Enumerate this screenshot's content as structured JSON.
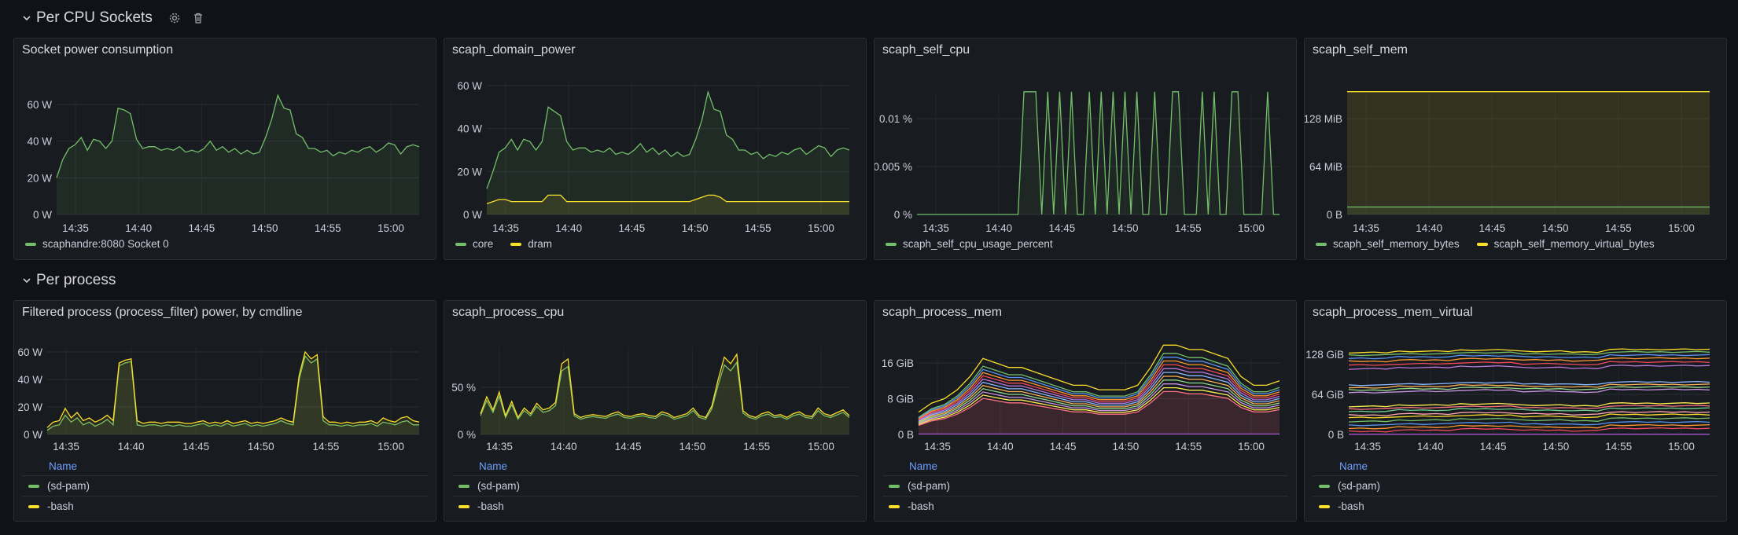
{
  "rows": [
    {
      "title": "Per CPU Sockets"
    },
    {
      "title": "Per process"
    }
  ],
  "colors": {
    "green": "#73bf69",
    "yellow": "#fade2a",
    "purple": "#a352cc",
    "blue_link": "#6e9fff"
  },
  "x_ticks": [
    "14:35",
    "14:40",
    "14:45",
    "14:50",
    "14:55",
    "15:00"
  ],
  "panels": [
    {
      "title": "Socket power consumption",
      "y_ticks": [
        "0 W",
        "20 W",
        "40 W",
        "60 W"
      ],
      "legend": [
        {
          "name": "scaphandre:8080 Socket 0",
          "color": "#73bf69"
        }
      ]
    },
    {
      "title": "scaph_domain_power",
      "y_ticks": [
        "0 W",
        "20 W",
        "40 W",
        "60 W"
      ],
      "legend": [
        {
          "name": "core",
          "color": "#73bf69"
        },
        {
          "name": "dram",
          "color": "#fade2a"
        }
      ]
    },
    {
      "title": "scaph_self_cpu",
      "y_ticks": [
        "0 %",
        "0.005 %",
        "0.01 %"
      ],
      "legend": [
        {
          "name": "scaph_self_cpu_usage_percent",
          "color": "#73bf69"
        }
      ]
    },
    {
      "title": "scaph_self_mem",
      "y_ticks": [
        "0 B",
        "64 MiB",
        "128 MiB"
      ],
      "legend": [
        {
          "name": "scaph_self_memory_bytes",
          "color": "#73bf69"
        },
        {
          "name": "scaph_self_memory_virtual_bytes",
          "color": "#fade2a"
        }
      ]
    },
    {
      "title": "Filtered process (process_filter) power, by cmdline",
      "y_ticks": [
        "0 W",
        "20 W",
        "40 W",
        "60 W"
      ],
      "table_header": "Name",
      "legend": [
        {
          "name": "(sd-pam)",
          "color": "#73bf69"
        },
        {
          "name": "-bash",
          "color": "#fade2a"
        }
      ]
    },
    {
      "title": "scaph_process_cpu",
      "y_ticks": [
        "0 %",
        "50 %"
      ],
      "table_header": "Name",
      "legend": [
        {
          "name": "(sd-pam)",
          "color": "#73bf69"
        },
        {
          "name": "-bash",
          "color": "#fade2a"
        }
      ]
    },
    {
      "title": "scaph_process_mem",
      "y_ticks": [
        "0 B",
        "8 GiB",
        "16 GiB"
      ],
      "table_header": "Name",
      "legend": [
        {
          "name": "(sd-pam)",
          "color": "#73bf69"
        },
        {
          "name": "-bash",
          "color": "#fade2a"
        }
      ]
    },
    {
      "title": "scaph_process_mem_virtual",
      "y_ticks": [
        "0 B",
        "64 GiB",
        "128 GiB"
      ],
      "table_header": "Name",
      "legend": [
        {
          "name": "(sd-pam)",
          "color": "#73bf69"
        },
        {
          "name": "-bash",
          "color": "#fade2a"
        }
      ]
    }
  ],
  "series": {
    "socket_power": [
      20,
      30,
      36,
      38,
      42,
      35,
      41,
      40,
      36,
      40,
      58,
      57,
      55,
      41,
      36,
      37,
      37,
      35,
      36,
      35,
      37,
      34,
      35,
      34,
      36,
      40,
      35,
      37,
      34,
      36,
      33,
      35,
      33,
      34,
      42,
      52,
      65,
      58,
      57,
      44,
      42,
      36,
      36,
      34,
      35,
      32,
      34,
      33,
      35,
      34,
      36,
      37,
      34,
      36,
      39,
      38,
      33,
      37,
      38,
      37
    ],
    "core_power": [
      12,
      20,
      29,
      31,
      35,
      30,
      35,
      34,
      30,
      34,
      50,
      48,
      46,
      34,
      30,
      31,
      31,
      29,
      30,
      29,
      31,
      28,
      29,
      28,
      30,
      33,
      29,
      31,
      28,
      30,
      27,
      29,
      27,
      28,
      35,
      44,
      57,
      49,
      48,
      37,
      35,
      30,
      30,
      28,
      29,
      26,
      28,
      27,
      29,
      28,
      30,
      31,
      28,
      30,
      32,
      31,
      27,
      30,
      31,
      30
    ],
    "dram_power": [
      5,
      6,
      7,
      7,
      6,
      6,
      6,
      6,
      6,
      6,
      9,
      9,
      9,
      6,
      6,
      6,
      6,
      6,
      6,
      6,
      6,
      6,
      6,
      6,
      6,
      6,
      6,
      6,
      6,
      6,
      6,
      6,
      6,
      6,
      7,
      8,
      9,
      9,
      8,
      6,
      6,
      6,
      6,
      6,
      6,
      6,
      6,
      6,
      6,
      6,
      6,
      6,
      6,
      6,
      6,
      6,
      6,
      6,
      6,
      6
    ],
    "self_cpu_pattern": [
      0,
      0,
      0,
      0,
      0,
      0,
      0,
      0,
      0,
      1,
      1,
      1,
      0,
      1,
      0,
      1,
      0,
      1,
      0,
      0,
      1,
      0,
      1,
      0,
      1,
      0,
      1,
      0,
      1,
      0,
      0,
      1,
      0,
      0,
      1,
      1,
      0,
      0,
      0,
      1,
      0,
      1,
      0,
      0,
      1,
      1,
      0,
      0,
      0,
      0,
      1,
      0,
      0,
      0,
      0,
      1
    ],
    "proc_power_bash": [
      5,
      9,
      10,
      19,
      12,
      16,
      10,
      12,
      9,
      11,
      14,
      10,
      52,
      54,
      55,
      10,
      8,
      9,
      9,
      8,
      9,
      9,
      9,
      8,
      8,
      9,
      10,
      8,
      9,
      8,
      10,
      8,
      9,
      10,
      8,
      9,
      8,
      9,
      10,
      12,
      10,
      9,
      43,
      60,
      55,
      58,
      13,
      9,
      9,
      8,
      9,
      8,
      9,
      9,
      10,
      8,
      12,
      10,
      9,
      12,
      13,
      10,
      9
    ],
    "proc_power_sdpam": [
      3,
      6,
      7,
      14,
      9,
      12,
      7,
      9,
      6,
      8,
      11,
      7,
      50,
      52,
      53,
      7,
      6,
      7,
      7,
      6,
      7,
      6,
      7,
      6,
      6,
      7,
      8,
      6,
      7,
      6,
      8,
      6,
      7,
      8,
      6,
      7,
      6,
      7,
      8,
      10,
      8,
      7,
      40,
      57,
      52,
      55,
      10,
      7,
      7,
      6,
      7,
      6,
      7,
      7,
      8,
      6,
      9,
      8,
      7,
      9,
      10,
      7,
      7
    ],
    "proc_cpu": [
      22,
      40,
      26,
      45,
      20,
      35,
      18,
      28,
      22,
      33,
      26,
      28,
      34,
      75,
      80,
      22,
      18,
      20,
      21,
      20,
      19,
      22,
      24,
      20,
      19,
      21,
      22,
      20,
      19,
      24,
      22,
      18,
      20,
      22,
      28,
      20,
      18,
      30,
      58,
      82,
      75,
      85,
      25,
      20,
      18,
      22,
      24,
      20,
      21,
      18,
      22,
      24,
      20,
      19,
      28,
      22,
      20,
      23,
      26,
      20
    ]
  }
}
